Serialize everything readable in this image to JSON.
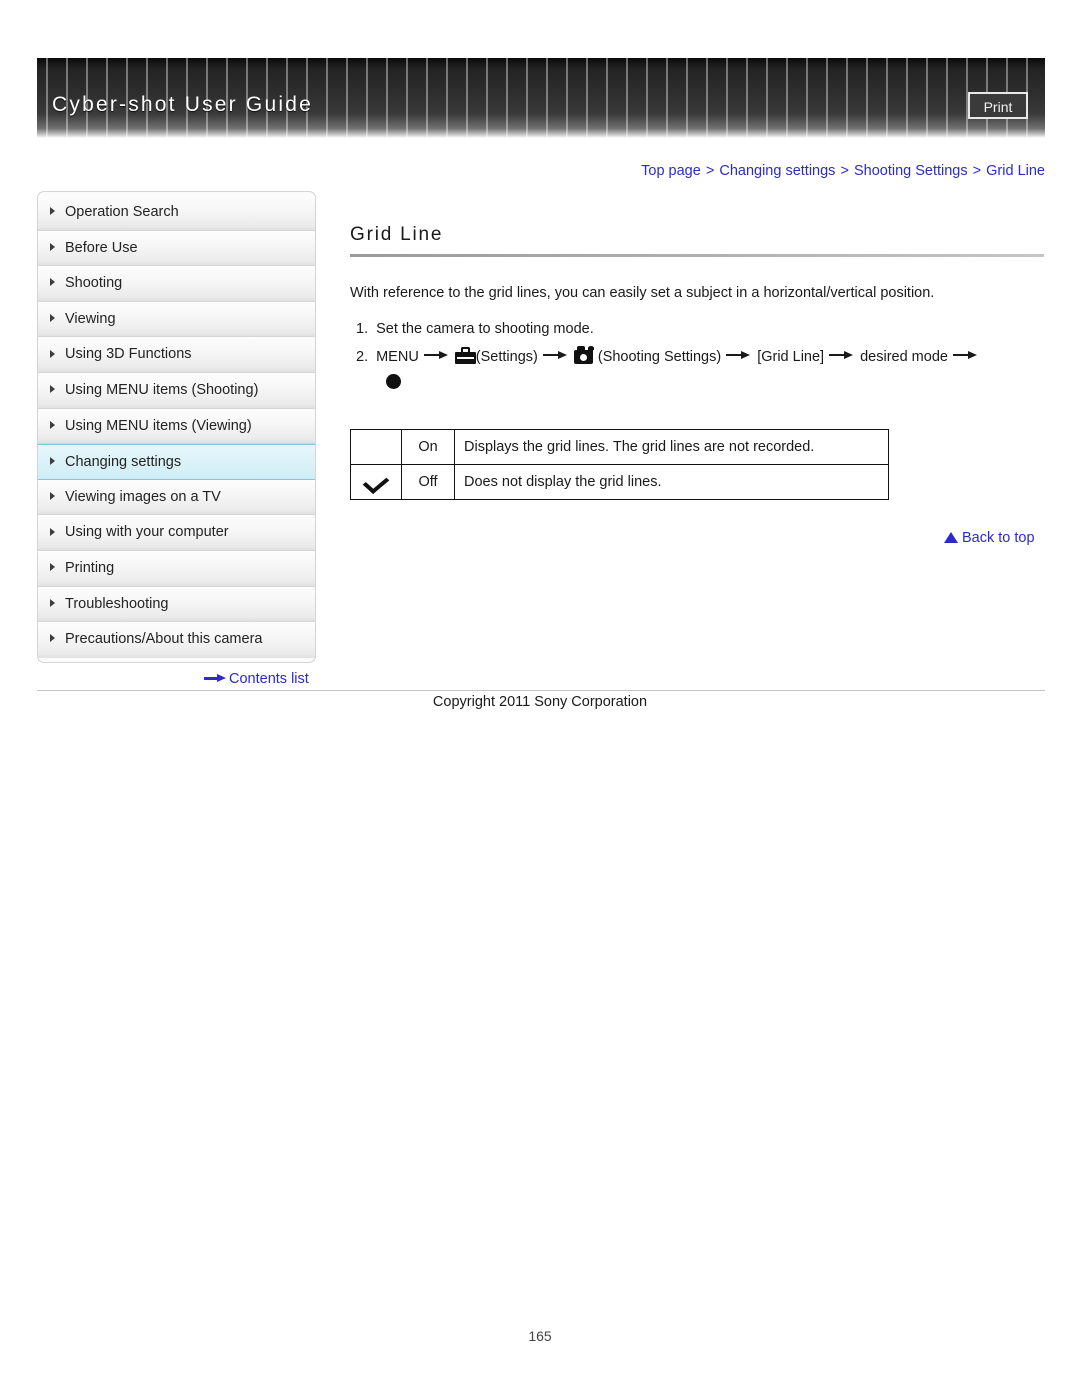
{
  "header": {
    "title": "Cyber-shot User Guide",
    "print_label": "Print"
  },
  "breadcrumb": {
    "separator": ">",
    "items": [
      {
        "label": "Top page"
      },
      {
        "label": "Changing settings"
      },
      {
        "label": "Shooting Settings"
      },
      {
        "label": "Grid Line"
      }
    ]
  },
  "sidebar": {
    "items": [
      {
        "label": "Operation Search",
        "active": false
      },
      {
        "label": "Before Use",
        "active": false
      },
      {
        "label": "Shooting",
        "active": false
      },
      {
        "label": "Viewing",
        "active": false
      },
      {
        "label": "Using 3D Functions",
        "active": false
      },
      {
        "label": "Using MENU items (Shooting)",
        "active": false
      },
      {
        "label": "Using MENU items (Viewing)",
        "active": false
      },
      {
        "label": "Changing settings",
        "active": true
      },
      {
        "label": "Viewing images on a TV",
        "active": false
      },
      {
        "label": "Using with your computer",
        "active": false
      },
      {
        "label": "Printing",
        "active": false
      },
      {
        "label": "Troubleshooting",
        "active": false
      },
      {
        "label": "Precautions/About this camera",
        "active": false
      }
    ],
    "contents_link": "Contents list"
  },
  "main": {
    "title": "Grid Line",
    "intro": "With reference to the grid lines, you can easily set a subject in a horizontal/vertical position.",
    "steps": [
      {
        "number": "1.",
        "text": "Set the camera to shooting mode."
      },
      {
        "number": "2.",
        "menu_label": "MENU",
        "settings_label": "(Settings)",
        "shooting_settings_label": "(Shooting Settings)",
        "grid_line_label": "[Grid Line]",
        "desired_mode_label": "desired mode"
      }
    ],
    "options_table": {
      "rows": [
        {
          "checked": false,
          "mode": "On",
          "description": "Displays the grid lines. The grid lines are not recorded."
        },
        {
          "checked": true,
          "mode": "Off",
          "description": "Does not display the grid lines."
        }
      ]
    },
    "back_to_top": "Back to top"
  },
  "footer": {
    "copyright": "Copyright 2011 Sony Corporation",
    "page_number": "165"
  },
  "colors": {
    "link": "#2b2bc8",
    "active_nav_bg": "#dbf2f8",
    "header_bg": "#2e2e2e"
  }
}
